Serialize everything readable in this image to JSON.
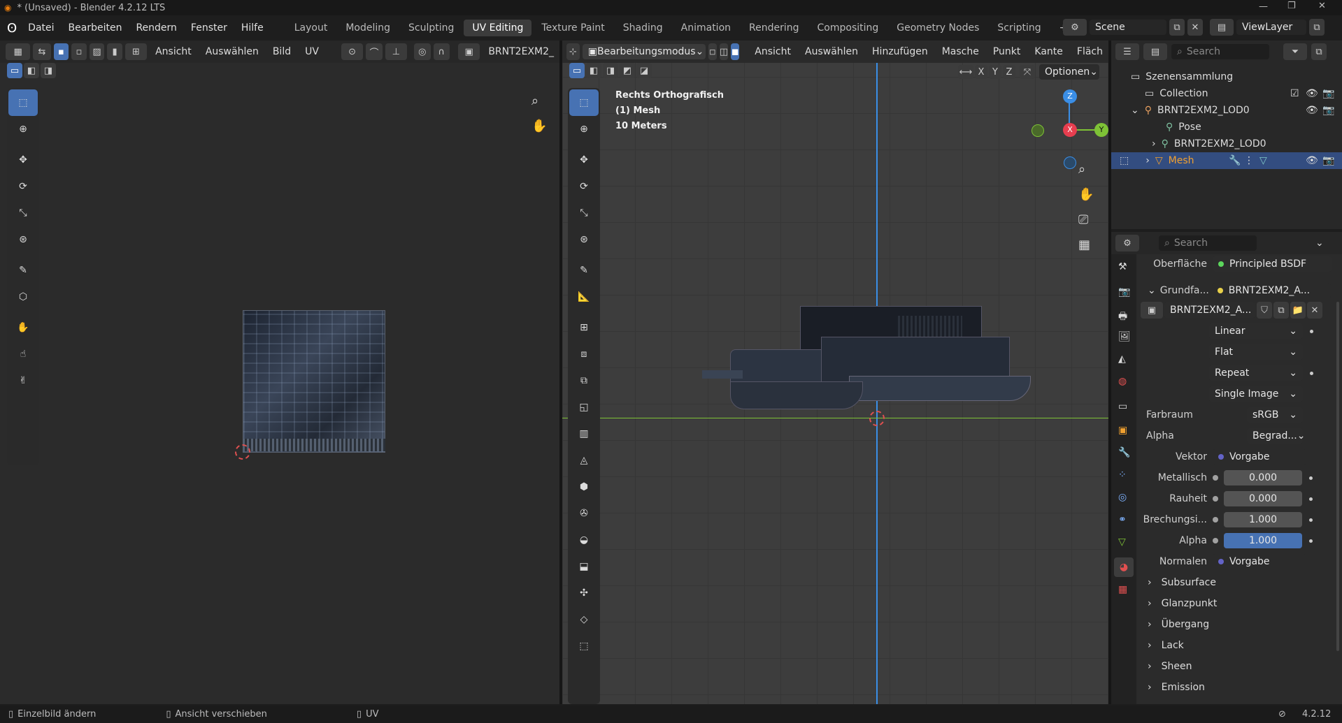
{
  "title": "* (Unsaved) - Blender 4.2.12 LTS",
  "menu": [
    "Datei",
    "Bearbeiten",
    "Rendern",
    "Fenster",
    "Hilfe"
  ],
  "workspaces": [
    "Layout",
    "Modeling",
    "Sculpting",
    "UV Editing",
    "Texture Paint",
    "Shading",
    "Animation",
    "Rendering",
    "Compositing",
    "Geometry Nodes",
    "Scripting"
  ],
  "active_workspace": "UV Editing",
  "scene": "Scene",
  "view_layer": "ViewLayer",
  "uv_header": {
    "ansicht": "Ansicht",
    "auswaehlen": "Auswählen",
    "bild": "Bild",
    "uv": "UV",
    "image_name": "BRNT2EXM2_"
  },
  "viewport_header": {
    "mode": "Bearbeitungsmodus",
    "ansicht": "Ansicht",
    "auswaehlen": "Auswählen",
    "hinzufuegen": "Hinzufügen",
    "masche": "Masche",
    "punkt": "Punkt",
    "kante": "Kante",
    "flaeche": "Fläch",
    "optionen": "Optionen",
    "axes": [
      "X",
      "Y",
      "Z"
    ]
  },
  "viewport_info": {
    "view": "Rechts Orthografisch",
    "object": "(1) Mesh",
    "scale": "10 Meters"
  },
  "gizmo": {
    "x": "X",
    "y": "Y",
    "z": "Z",
    "colors": {
      "x": "#e73e4f",
      "y": "#7ec236",
      "z": "#3a8ee6"
    }
  },
  "outliner": {
    "search": "Search",
    "rows": [
      {
        "label": "Szenensammlung"
      },
      {
        "label": "Collection"
      },
      {
        "label": "BRNT2EXM2_LOD0"
      },
      {
        "label": "Pose"
      },
      {
        "label": "BRNT2EXM2_LOD0"
      },
      {
        "label": "Mesh"
      }
    ]
  },
  "properties": {
    "search": "Search",
    "oberflaeche_label": "Oberfläche",
    "oberflaeche_value": "Principled BSDF",
    "grundfarbe_label": "Grundfa...",
    "grundfarbe_value": "BRNT2EXM2_A...",
    "image_name": "BRNT2EXM2_A...",
    "interp": "Linear",
    "proj": "Flat",
    "ext": "Repeat",
    "source": "Single Image",
    "farbraum_label": "Farbraum",
    "farbraum": "sRGB",
    "alpha_label": "Alpha",
    "alpha_mode": "Begrad...",
    "vektor_label": "Vektor",
    "vektor": "Vorgabe",
    "metallisch_label": "Metallisch",
    "metallisch": "0.000",
    "rauheit_label": "Rauheit",
    "rauheit": "0.000",
    "brechung_label": "Brechungsi...",
    "brechung": "1.000",
    "alpha2_label": "Alpha",
    "alpha2": "1.000",
    "normalen_label": "Normalen",
    "normalen": "Vorgabe",
    "sections": [
      "Subsurface",
      "Glanzpunkt",
      "Übergang",
      "Lack",
      "Sheen",
      "Emission"
    ]
  },
  "status": {
    "left": "Einzelbild ändern",
    "mid": "Ansicht verschieben",
    "right": "UV",
    "version": "4.2.12"
  },
  "accent": "#4772b3"
}
